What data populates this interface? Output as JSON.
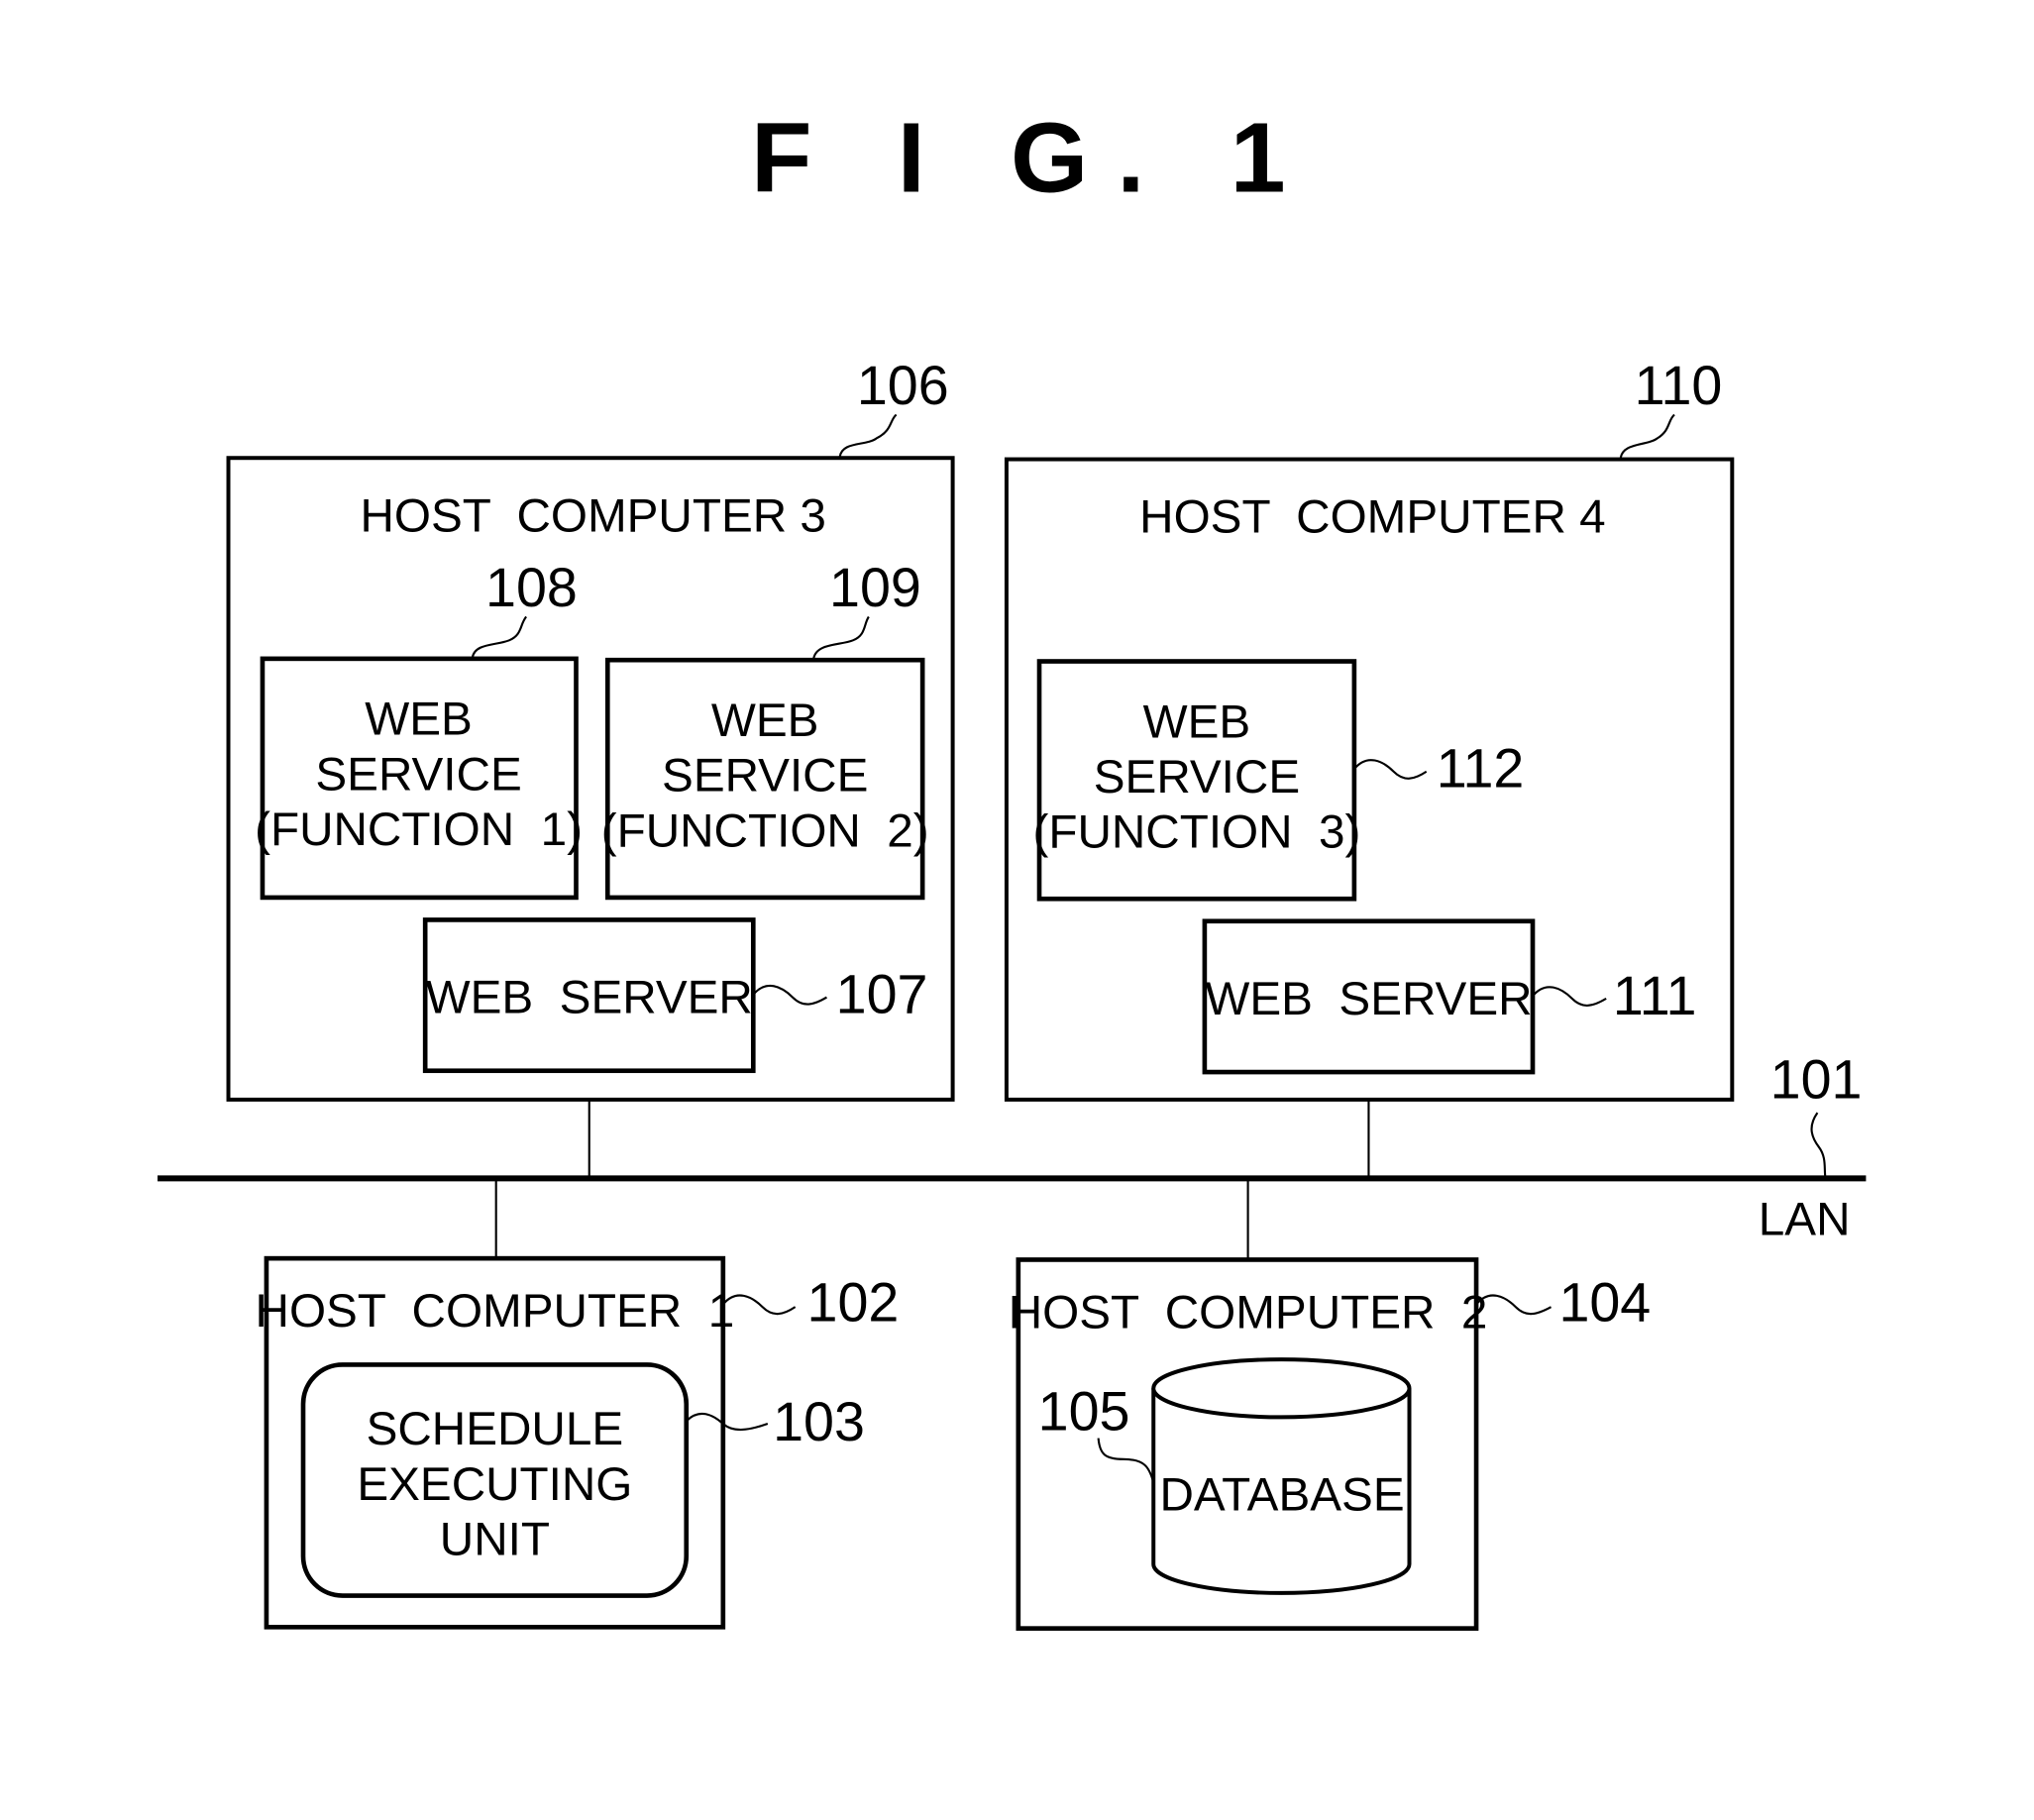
{
  "figure": {
    "title": "F I G. 1"
  },
  "network": {
    "label": "LAN",
    "ref": "101"
  },
  "host_computer_3": {
    "label": "HOST  COMPUTER 3",
    "ref": "106",
    "web_service_1": {
      "lines": [
        "WEB",
        "SERVICE",
        "(FUNCTION  1)"
      ],
      "ref": "108"
    },
    "web_service_2": {
      "lines": [
        "WEB",
        "SERVICE",
        "(FUNCTION  2)"
      ],
      "ref": "109"
    },
    "web_server": {
      "label": "WEB  SERVER",
      "ref": "107"
    }
  },
  "host_computer_4": {
    "label": "HOST  COMPUTER 4",
    "ref": "110",
    "web_service_3": {
      "lines": [
        "WEB",
        "SERVICE",
        "(FUNCTION  3)"
      ],
      "ref": "112"
    },
    "web_server": {
      "label": "WEB  SERVER",
      "ref": "111"
    }
  },
  "host_computer_1": {
    "label": "HOST  COMPUTER  1",
    "ref": "102",
    "schedule_unit": {
      "lines": [
        "SCHEDULE",
        "EXECUTING",
        "UNIT"
      ],
      "ref": "103"
    }
  },
  "host_computer_2": {
    "label": "HOST  COMPUTER  2",
    "ref": "104",
    "database": {
      "label": "DATABASE",
      "ref": "105"
    }
  }
}
